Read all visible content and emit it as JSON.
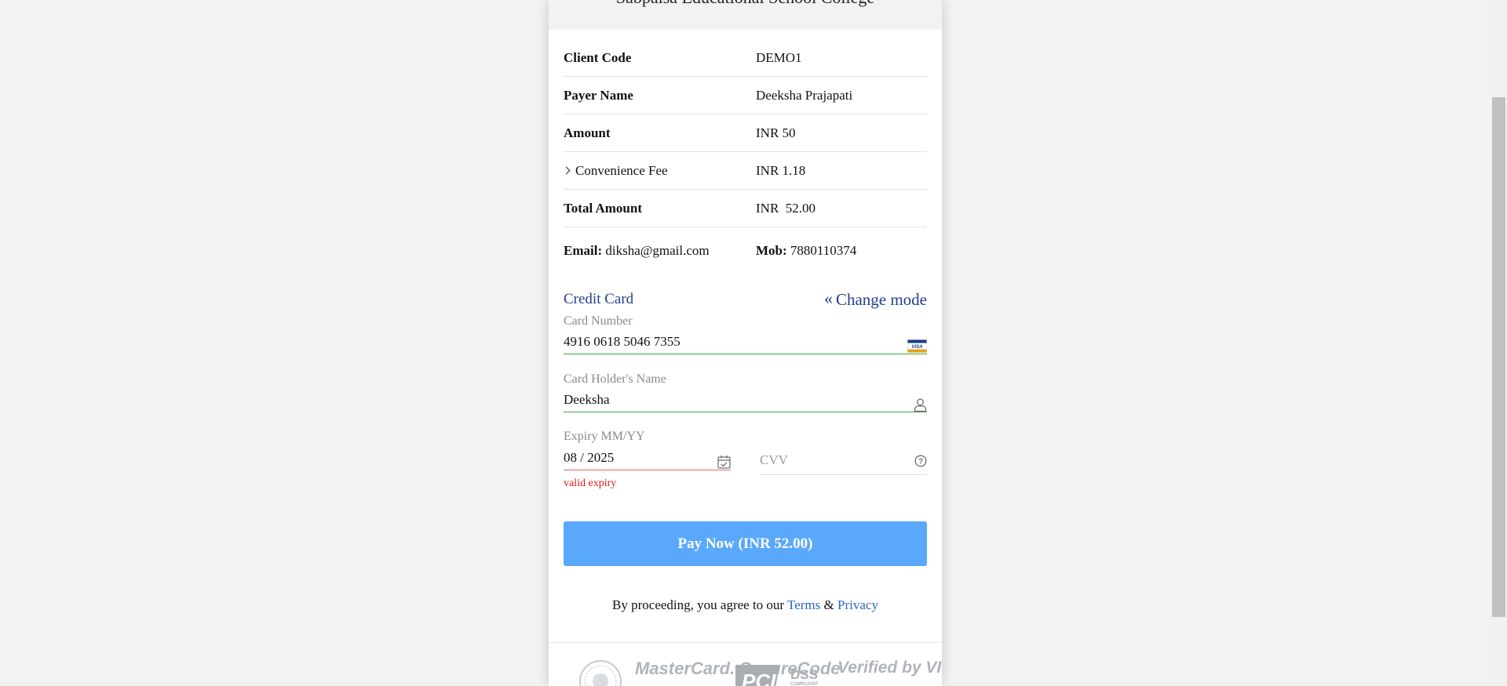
{
  "header": {
    "title": "Sabpaisa Educational School College"
  },
  "details": {
    "rows": [
      {
        "label": "Client Code",
        "value": "DEMO1"
      },
      {
        "label": "Payer Name",
        "value": "Deeksha Prajapati"
      },
      {
        "label": "Amount",
        "value": "INR 50"
      },
      {
        "label": "Convenience Fee",
        "value": "INR 1.18"
      },
      {
        "label": "Total Amount",
        "value": "INR  52.00"
      }
    ]
  },
  "contact": {
    "email_label": "Email:",
    "email_value": "diksha@gmail.com",
    "mob_label": "Mob:",
    "mob_value": "7880110374"
  },
  "payment": {
    "mode_title": "Credit Card",
    "change_mode_label": "Change mode",
    "card_number_label": "Card Number",
    "card_number_value": "4916 0618 5046 7355",
    "card_holder_label": "Card Holder's Name",
    "card_holder_value": "Deeksha",
    "expiry_label": "Expiry MM/YY",
    "expiry_value": "08 / 2025",
    "expiry_error": "valid expiry",
    "cvv_placeholder": "CVV",
    "pay_button_label": "Pay Now (INR 52.00)"
  },
  "terms": {
    "prefix": "By proceeding, you agree to our ",
    "terms_link": "Terms",
    "amp": " & ",
    "privacy_link": "Privacy"
  },
  "footer": {
    "logos": [
      "MasterCard. SecureCode",
      "PCI DSS COMPLIANT",
      "Verified by VISA"
    ],
    "icons": [
      "emblem-seal-icon"
    ]
  },
  "colors": {
    "accent_blue": "#23408e",
    "pay_button": "#5aa8fb",
    "link": "#2a66c9",
    "valid_border": "#3aaa3a",
    "error": "#e01b1b"
  }
}
